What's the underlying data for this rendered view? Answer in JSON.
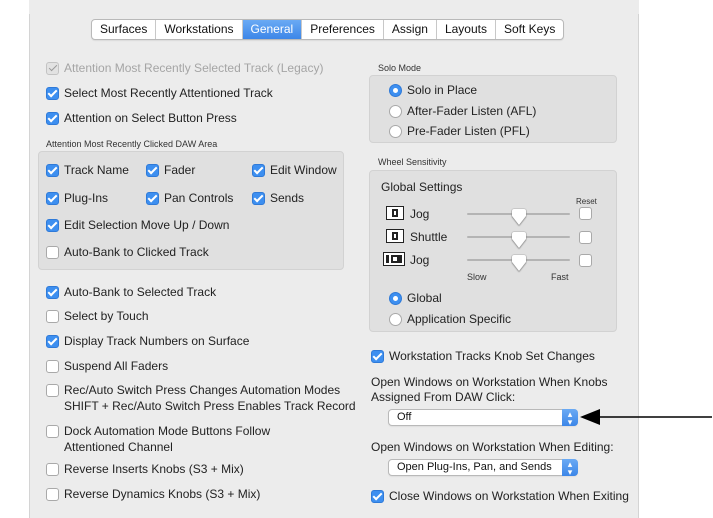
{
  "tabs": [
    "Surfaces",
    "Workstations",
    "General",
    "Preferences",
    "Assign",
    "Layouts",
    "Soft Keys"
  ],
  "active_tab": "General",
  "left": {
    "attention_legacy": "Attention Most Recently Selected Track (Legacy)",
    "select_recent": "Select Most Recently Attentioned Track",
    "attention_button": "Attention on Select Button Press",
    "clicked_area_label": "Attention Most Recently Clicked DAW Area",
    "track_name": "Track Name",
    "fader": "Fader",
    "edit_window": "Edit Window",
    "plugins": "Plug-Ins",
    "pan_controls": "Pan Controls",
    "sends": "Sends",
    "edit_selection": "Edit Selection Move Up / Down",
    "auto_bank_clicked": "Auto-Bank to Clicked Track",
    "auto_bank_selected": "Auto-Bank to Selected Track",
    "select_by_touch": "Select by Touch",
    "display_track_numbers": "Display Track Numbers on Surface",
    "suspend_faders": "Suspend All Faders",
    "rec_auto_line1": "Rec/Auto Switch Press Changes Automation Modes",
    "rec_auto_line2": "SHIFT + Rec/Auto Switch Press Enables Track Record",
    "dock_line1": "Dock Automation Mode Buttons Follow",
    "dock_line2": "Attentioned Channel",
    "reverse_inserts": "Reverse Inserts Knobs (S3 + Mix)",
    "reverse_dynamics": "Reverse Dynamics Knobs (S3 + Mix)"
  },
  "solo": {
    "label": "Solo Mode",
    "options": [
      "Solo in Place",
      "After-Fader Listen (AFL)",
      "Pre-Fader Listen (PFL)"
    ]
  },
  "wheel": {
    "label": "Wheel Sensitivity",
    "global_settings": "Global Settings",
    "reset": "Reset",
    "rows": [
      "Jog",
      "Shuttle",
      "Jog"
    ],
    "levels": [
      0.5,
      0.5,
      0.5
    ],
    "slow": "Slow",
    "fast": "Fast",
    "scope_options": [
      "Global",
      "Application Specific"
    ]
  },
  "right": {
    "knob_set_changes": "Workstation Tracks Knob Set Changes",
    "open_knobs_line1": "Open Windows on Workstation When Knobs",
    "open_knobs_line2": "Assigned From DAW Click:",
    "knobs_popup": "Off",
    "open_editing": "Open Windows on Workstation When Editing:",
    "editing_popup": "Open Plug-Ins, Pan, and Sends",
    "close_windows": "Close Windows on Workstation When Exiting"
  },
  "colors": {
    "accent": "#3d8ff0",
    "panel": "#ececec",
    "group": "#e0e0e0"
  }
}
